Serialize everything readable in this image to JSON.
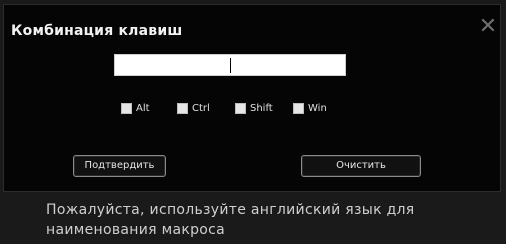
{
  "dialog": {
    "title": "Комбинация клавиш",
    "close_glyph": "✕",
    "key_input": {
      "value": "",
      "placeholder": ""
    },
    "modifiers": [
      {
        "label": "Alt",
        "checked": false
      },
      {
        "label": "Ctrl",
        "checked": false
      },
      {
        "label": "Shift",
        "checked": false
      },
      {
        "label": "Win",
        "checked": false
      }
    ],
    "confirm_label": "Подтвердить",
    "clear_label": "Очистить"
  },
  "hint": "Пожалуйста, используйте английский язык для наименования макроса",
  "colors": {
    "dialog_background": "#050505",
    "window_background": "#1a1a1a",
    "text": "#e0e0e0"
  },
  "icons": {
    "close": "close-icon"
  }
}
